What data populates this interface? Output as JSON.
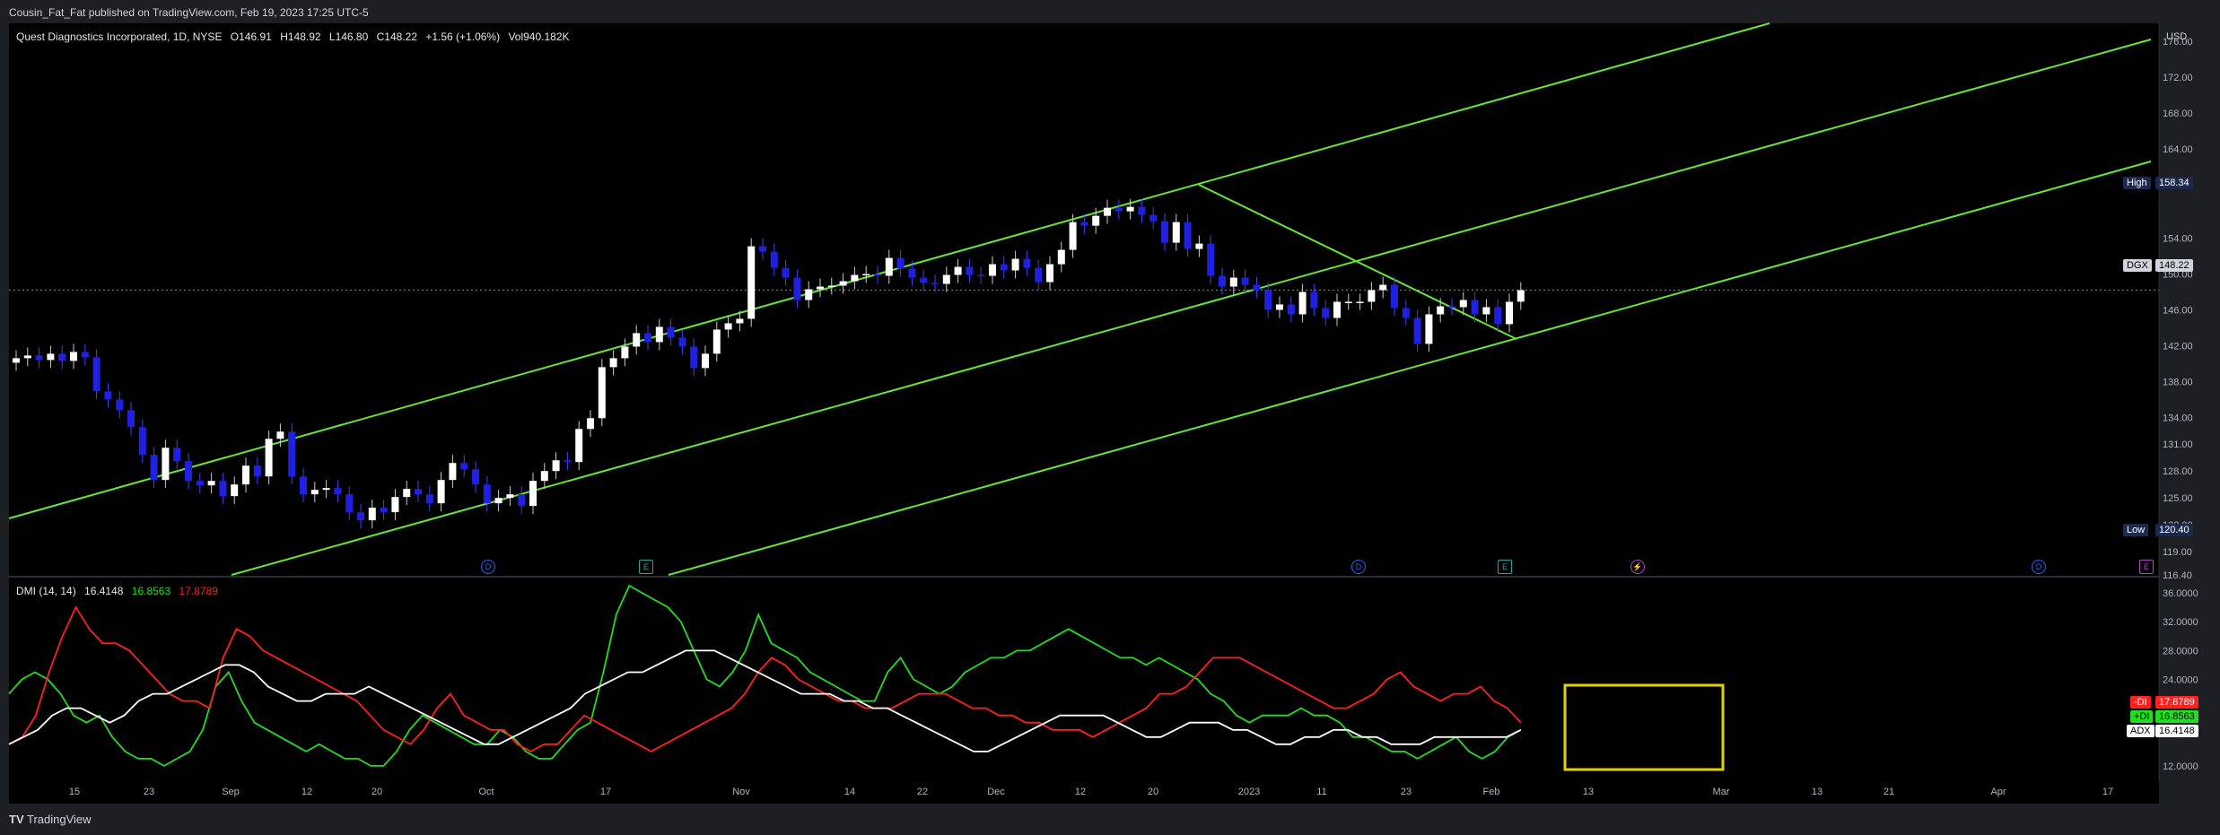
{
  "header": {
    "published": "Cousin_Fat_Fat published on TradingView.com, Feb 19, 2023 17:25 UTC-5"
  },
  "legend": {
    "symbol": "Quest Diagnostics Incorporated, 1D, NYSE",
    "open": "O146.91",
    "high": "H148.92",
    "low": "L146.80",
    "close": "C148.22",
    "change": "+1.56 (+1.06%)",
    "volume": "Vol940.182K"
  },
  "price_axis": {
    "currency": "USD",
    "ticks": [
      "176.00",
      "172.00",
      "168.00",
      "164.00",
      "160.00",
      "154.00",
      "150.00",
      "146.00",
      "142.00",
      "138.00",
      "134.00",
      "131.00",
      "128.00",
      "125.00",
      "122.00",
      "119.00",
      "116.40"
    ]
  },
  "price_tags": {
    "high_label": "High",
    "high_value": "158.34",
    "last_label": "DGX",
    "last_value": "148.22",
    "low_label": "Low",
    "low_value": "120.40"
  },
  "time_axis": [
    "15",
    "23",
    "Sep",
    "12",
    "20",
    "Oct",
    "17",
    "Nov",
    "14",
    "22",
    "Dec",
    "12",
    "20",
    "2023",
    "11",
    "23",
    "Feb",
    "13",
    "Mar",
    "13",
    "21",
    "Apr",
    "17"
  ],
  "events": [
    {
      "label": "D",
      "color": "#2962ff"
    },
    {
      "label": "E",
      "color": "#26a69a"
    },
    {
      "label": "D",
      "color": "#2962ff"
    },
    {
      "label": "E",
      "color": "#26a69a"
    },
    {
      "label": "⚡",
      "color": "#ab47bc"
    },
    {
      "label": "D",
      "color": "#2962ff"
    },
    {
      "label": "E",
      "color": "#ab47bc"
    }
  ],
  "dmi": {
    "title": "DMI (14, 14)",
    "adx_value": "16.4148",
    "plus_value": "16.8563",
    "minus_value": "17.8789",
    "ticks": [
      "36.0000",
      "32.0000",
      "28.0000",
      "24.0000",
      "12.0000"
    ],
    "minus_tag": "-DI",
    "plus_tag": "+DI",
    "adx_tag": "ADX"
  },
  "colors": {
    "bull": "#ffffff",
    "bear": "#2020e0",
    "channel": "#66e63a",
    "plus": "#22dd22",
    "minus": "#ff2020",
    "adx": "#ffffff",
    "box": "#e6d000"
  },
  "footer": {
    "brand": "TradingView"
  },
  "chart_data": [
    {
      "type": "candlestick",
      "title": "Quest Diagnostics Incorporated, 1D, NYSE",
      "ylim": [
        116.4,
        178
      ],
      "x": [
        "Aug 10",
        "Aug 11",
        "Aug 12",
        "Aug 15",
        "Aug 16",
        "Aug 17",
        "Aug 18",
        "Aug 19",
        "Aug 22",
        "Aug 23",
        "Aug 24",
        "Aug 25",
        "Aug 26",
        "Aug 29",
        "Aug 30",
        "Aug 31",
        "Sep 1",
        "Sep 2",
        "Sep 6",
        "Sep 7",
        "Sep 8",
        "Sep 9",
        "Sep 12",
        "Sep 13",
        "Sep 14",
        "Sep 15",
        "Sep 16",
        "Sep 19",
        "Sep 20",
        "Sep 21",
        "Sep 22",
        "Sep 23",
        "Sep 26",
        "Sep 27",
        "Sep 28",
        "Sep 29",
        "Sep 30",
        "Oct 3",
        "Oct 4",
        "Oct 5",
        "Oct 6",
        "Oct 7",
        "Oct 10",
        "Oct 11",
        "Oct 12",
        "Oct 13",
        "Oct 14",
        "Oct 17",
        "Oct 18",
        "Oct 19",
        "Oct 20",
        "Oct 21",
        "Oct 24",
        "Oct 25",
        "Oct 26",
        "Oct 27",
        "Oct 28",
        "Oct 31",
        "Nov 1",
        "Nov 2",
        "Nov 3",
        "Nov 4",
        "Nov 7",
        "Nov 8",
        "Nov 9",
        "Nov 10",
        "Nov 11",
        "Nov 14",
        "Nov 15",
        "Nov 16",
        "Nov 17",
        "Nov 18",
        "Nov 21",
        "Nov 22",
        "Nov 23",
        "Nov 25",
        "Nov 28",
        "Nov 29",
        "Nov 30",
        "Dec 1",
        "Dec 2",
        "Dec 5",
        "Dec 6",
        "Dec 7",
        "Dec 8",
        "Dec 9",
        "Dec 12",
        "Dec 13",
        "Dec 14",
        "Dec 15",
        "Dec 16",
        "Dec 19",
        "Dec 20",
        "Dec 21",
        "Dec 22",
        "Dec 23",
        "Dec 27",
        "Dec 28",
        "Dec 29",
        "Dec 30",
        "Jan 3",
        "Jan 4",
        "Jan 5",
        "Jan 6",
        "Jan 9",
        "Jan 10",
        "Jan 11",
        "Jan 12",
        "Jan 13",
        "Jan 17",
        "Jan 18",
        "Jan 19",
        "Jan 20",
        "Jan 23",
        "Jan 24",
        "Jan 25",
        "Jan 26",
        "Jan 27",
        "Jan 30",
        "Jan 31",
        "Feb 1",
        "Feb 2",
        "Feb 3",
        "Feb 6",
        "Feb 7",
        "Feb 8",
        "Feb 9",
        "Feb 10",
        "Feb 13",
        "Feb 14",
        "Feb 15",
        "Feb 16",
        "Feb 17"
      ],
      "close": [
        140.6,
        140.9,
        140.4,
        141.1,
        140.3,
        141.3,
        140.7,
        136.9,
        136.0,
        134.8,
        132.9,
        129.8,
        127.0,
        130.6,
        129.1,
        126.9,
        126.4,
        126.9,
        125.2,
        126.5,
        128.6,
        127.4,
        131.6,
        132.4,
        127.4,
        125.4,
        125.9,
        126.1,
        125.4,
        123.4,
        122.5,
        123.9,
        123.4,
        125.1,
        126.0,
        125.4,
        124.4,
        127.0,
        128.9,
        128.2,
        126.5,
        124.4,
        125.0,
        125.4,
        124.1,
        126.9,
        128.0,
        129.2,
        129.0,
        132.7,
        133.9,
        139.6,
        140.6,
        141.9,
        143.4,
        142.4,
        144.1,
        142.9,
        141.9,
        139.5,
        141.1,
        143.8,
        144.5,
        145.0,
        153.1,
        152.5,
        150.7,
        149.6,
        147.1,
        148.3,
        148.6,
        148.7,
        149.2,
        149.9,
        150.0,
        149.8,
        151.8,
        150.6,
        149.6,
        149.0,
        148.9,
        149.9,
        150.8,
        149.9,
        149.8,
        151.1,
        150.4,
        151.7,
        150.7,
        149.1,
        151.1,
        152.7,
        155.8,
        155.4,
        156.5,
        157.4,
        157.0,
        157.5,
        156.6,
        155.9,
        153.5,
        155.8,
        152.8,
        153.4,
        149.8,
        148.6,
        149.6,
        148.8,
        148.2,
        146.0,
        146.6,
        145.5,
        148.0,
        146.2,
        145.1,
        146.9,
        146.9,
        146.9,
        148.2,
        148.8,
        146.2,
        145.1,
        142.2,
        145.5,
        146.4,
        146.3,
        147.1,
        145.5,
        146.3,
        144.4,
        146.9,
        148.2
      ],
      "ylabel": "USD"
    },
    {
      "type": "line",
      "title": "DMI (14, 14)",
      "ylim": [
        10,
        38
      ],
      "series": [
        {
          "name": "+DI",
          "values": [
            22,
            24,
            25,
            24,
            22,
            19,
            18,
            19,
            16,
            14,
            13,
            13,
            12,
            13,
            14,
            17,
            23,
            25,
            21,
            18,
            17,
            16,
            15,
            14,
            15,
            14,
            13,
            13,
            12,
            12,
            14,
            17,
            19,
            18,
            17,
            16,
            15,
            15,
            17,
            16,
            14,
            13,
            13,
            15,
            17,
            18,
            25,
            33,
            37,
            36,
            35,
            34,
            32,
            28,
            24,
            23,
            25,
            28,
            33,
            29,
            28,
            27,
            25,
            24,
            23,
            22,
            21,
            21,
            25,
            27,
            24,
            23,
            22,
            23,
            25,
            26,
            27,
            27,
            28,
            28,
            29,
            30,
            31,
            30,
            29,
            28,
            27,
            27,
            26,
            27,
            26,
            25,
            24,
            22,
            21,
            19,
            18,
            19,
            19,
            19,
            20,
            19,
            19,
            18,
            16,
            16,
            15,
            14,
            14,
            13,
            14,
            15,
            16,
            14,
            13,
            14,
            16,
            17
          ]
        },
        {
          "name": "-DI",
          "values": [
            15,
            16,
            19,
            25,
            30,
            34,
            31,
            29,
            29,
            28,
            26,
            24,
            22,
            21,
            21,
            20,
            27,
            31,
            30,
            28,
            27,
            26,
            25,
            24,
            23,
            22,
            21,
            19,
            17,
            16,
            15,
            17,
            20,
            22,
            19,
            18,
            17,
            17,
            15,
            14,
            15,
            15,
            17,
            19,
            18,
            17,
            16,
            15,
            14,
            15,
            16,
            17,
            18,
            19,
            20,
            22,
            25,
            27,
            26,
            24,
            23,
            22,
            21,
            21,
            20,
            20,
            20,
            21,
            22,
            22,
            22,
            21,
            20,
            20,
            19,
            19,
            18,
            18,
            17,
            17,
            17,
            16,
            17,
            18,
            19,
            20,
            22,
            22,
            23,
            25,
            27,
            27,
            27,
            26,
            25,
            24,
            23,
            22,
            21,
            20,
            20,
            21,
            22,
            24,
            25,
            23,
            22,
            21,
            22,
            22,
            23,
            21,
            20,
            18
          ]
        },
        {
          "name": "ADX",
          "values": [
            15,
            16,
            17,
            19,
            20,
            20,
            19,
            18,
            19,
            21,
            22,
            22,
            23,
            24,
            25,
            26,
            26,
            25,
            23,
            22,
            21,
            21,
            22,
            22,
            22,
            23,
            22,
            21,
            20,
            19,
            18,
            17,
            16,
            15,
            15,
            16,
            17,
            18,
            19,
            20,
            22,
            23,
            24,
            25,
            25,
            26,
            27,
            28,
            28,
            28,
            27,
            26,
            25,
            24,
            23,
            22,
            22,
            22,
            21,
            21,
            20,
            20,
            19,
            18,
            17,
            16,
            15,
            14,
            14,
            15,
            16,
            17,
            18,
            19,
            19,
            19,
            19,
            18,
            17,
            16,
            16,
            17,
            18,
            18,
            18,
            17,
            17,
            16,
            15,
            15,
            16,
            16,
            17,
            17,
            16,
            16,
            15,
            15,
            15,
            16,
            16,
            16,
            16,
            16,
            16,
            17
          ]
        }
      ]
    }
  ]
}
